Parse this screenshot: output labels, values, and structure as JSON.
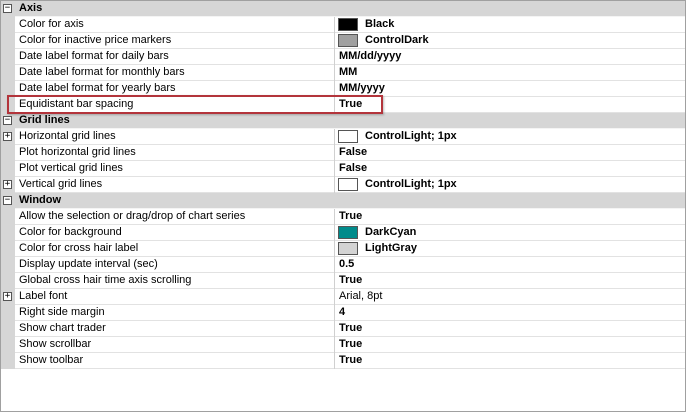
{
  "toggle_glyphs": {
    "collapse": "−",
    "expand": "+"
  },
  "categories": [
    {
      "label": "Axis",
      "rows": [
        {
          "name": "Color for axis",
          "value": "Black",
          "swatch": "#000000"
        },
        {
          "name": "Color for inactive price markers",
          "value": "ControlDark",
          "swatch": "#a0a0a0"
        },
        {
          "name": "Date label format for daily bars",
          "value": "MM/dd/yyyy"
        },
        {
          "name": "Date label format for monthly bars",
          "value": "MM"
        },
        {
          "name": "Date label format for yearly bars",
          "value": "MM/yyyy"
        },
        {
          "name": "Equidistant bar spacing",
          "value": "True",
          "highlighted": true
        }
      ]
    },
    {
      "label": "Grid lines",
      "rows": [
        {
          "name": "Horizontal grid lines",
          "value": "ControlLight; 1px",
          "swatch": "#ffffff",
          "expandable": true
        },
        {
          "name": "Plot horizontal grid lines",
          "value": "False"
        },
        {
          "name": "Plot vertical grid lines",
          "value": "False"
        },
        {
          "name": "Vertical grid lines",
          "value": "ControlLight; 1px",
          "swatch": "#ffffff",
          "expandable": true
        }
      ]
    },
    {
      "label": "Window",
      "rows": [
        {
          "name": "Allow the selection or drag/drop of chart series",
          "value": "True"
        },
        {
          "name": "Color for background",
          "value": "DarkCyan",
          "swatch": "#008b8b"
        },
        {
          "name": "Color for cross hair label",
          "value": "LightGray",
          "swatch": "#d3d3d3"
        },
        {
          "name": "Display update interval (sec)",
          "value": "0.5"
        },
        {
          "name": "Global cross hair time axis scrolling",
          "value": "True"
        },
        {
          "name": "Label font",
          "value": "Arial, 8pt",
          "plain": true,
          "expandable": true
        },
        {
          "name": "Right side margin",
          "value": "4"
        },
        {
          "name": "Show chart trader",
          "value": "True"
        },
        {
          "name": "Show scrollbar",
          "value": "True"
        },
        {
          "name": "Show toolbar",
          "value": "True"
        }
      ]
    }
  ],
  "colors": {
    "accent_highlight": "#b3343b",
    "category_bg": "#d6d6d6"
  }
}
